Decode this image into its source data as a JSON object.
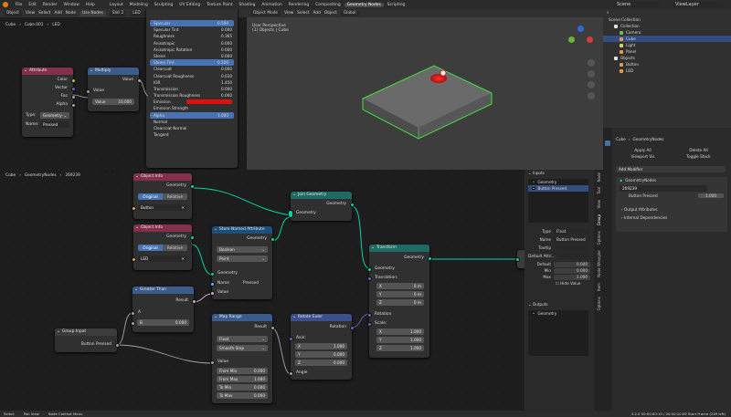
{
  "topbar": {
    "menus": [
      "File",
      "Edit",
      "Render",
      "Window",
      "Help"
    ],
    "workspaces": [
      "Layout",
      "Modeling",
      "Sculpting",
      "UV Editing",
      "Texture Paint",
      "Shading",
      "Animation",
      "Rendering",
      "Compositing",
      "Geometry Nodes",
      "Scripting"
    ],
    "active_workspace": "Geometry Nodes",
    "scene": "Scene",
    "view_layer": "ViewLayer"
  },
  "shader_editor": {
    "header": {
      "editor": "Object",
      "view": "View",
      "select": "Select",
      "add": "Add",
      "node": "Node",
      "use_nodes": "Use Nodes",
      "slot": "Slot 2",
      "material": "LED"
    },
    "breadcrumb": [
      "Cube",
      "Cube.001",
      "LED"
    ],
    "attribute_node": {
      "title": "Attribute",
      "outputs": [
        "Color",
        "Vector",
        "Fac",
        "Alpha"
      ],
      "type_label": "Type:",
      "type_value": "Geometry",
      "name_label": "Name:",
      "name_value": "Pressed"
    },
    "multiply_node": {
      "title": "Multiply",
      "value_out": "Value",
      "value_in": "Value",
      "value_field": "Value",
      "value_num": "10.000"
    },
    "bsdf_rows": [
      {
        "label": "Specular",
        "value": "0.500",
        "hl": true
      },
      {
        "label": "Specular Tint",
        "value": "0.000"
      },
      {
        "label": "Roughness",
        "value": "0.365"
      },
      {
        "label": "Anisotropic",
        "value": "0.000"
      },
      {
        "label": "Anisotropic Rotation",
        "value": "0.000"
      },
      {
        "label": "Sheen",
        "value": "0.000"
      },
      {
        "label": "Sheen Tint",
        "value": "0.500",
        "hl": true
      },
      {
        "label": "Clearcoat",
        "value": "0.000"
      },
      {
        "label": "Clearcoat Roughness",
        "value": "0.030"
      },
      {
        "label": "IOR",
        "value": "1.450"
      },
      {
        "label": "Transmission",
        "value": "0.000"
      },
      {
        "label": "Transmission Roughness",
        "value": "0.000"
      }
    ],
    "emission_label": "Emission",
    "emission_color": "#e01010",
    "emission_strength": "Emission Strength",
    "alpha_label": "Alpha",
    "alpha_value": "1.000",
    "normal": "Normal",
    "clearcoat_normal": "Clearcoat Normal",
    "tangent": "Tangent"
  },
  "viewport": {
    "header": {
      "mode": "Object Mode",
      "view": "View",
      "select": "Select",
      "add": "Add",
      "object": "Object",
      "orientation": "Global"
    },
    "overlay_title": "User Perspective",
    "overlay_subtitle": "(1) Objects | Cube"
  },
  "outliner": {
    "title": "Scene Collection",
    "items": [
      {
        "label": "Collection",
        "indent": 1,
        "icon": "collection-icon"
      },
      {
        "label": "Camera",
        "indent": 2,
        "icon": "camera-icon"
      },
      {
        "label": "Cube",
        "indent": 2,
        "icon": "mesh-icon",
        "selected": true
      },
      {
        "label": "Light",
        "indent": 2,
        "icon": "light-icon"
      },
      {
        "label": "Panel",
        "indent": 2,
        "icon": "mesh-icon"
      },
      {
        "label": "Objects",
        "indent": 1,
        "icon": "collection-icon"
      },
      {
        "label": "Button",
        "indent": 2,
        "icon": "mesh-icon"
      },
      {
        "label": "LED",
        "indent": 2,
        "icon": "mesh-icon"
      }
    ]
  },
  "properties": {
    "object": "Cube",
    "modifier_name": "GeometryNodes",
    "apply_all": "Apply All",
    "delete_all": "Delete All",
    "viewport_vis": "Viewport Vis",
    "toggle_stack": "Toggle Stack",
    "add_modifier": "Add Modifier",
    "mod_title": "GeometryNodes",
    "node_group": "269239",
    "button_pressed_label": "Button Pressed",
    "button_pressed_value": "1.000",
    "output_attributes": "Output Attributes",
    "internal_dependencies": "Internal Dependencies"
  },
  "geo_editor": {
    "breadcrumb": [
      "Cube",
      "GeometryNodes",
      "269239"
    ],
    "nodes": {
      "object_info_1": {
        "title": "Object Info",
        "geometry": "Geometry",
        "original": "Original",
        "relative": "Relative",
        "object": "Button"
      },
      "object_info_2": {
        "title": "Object Info",
        "geometry": "Geometry",
        "original": "Original",
        "relative": "Relative",
        "object": "LED"
      },
      "join": {
        "title": "Join Geometry",
        "out": "Geometry",
        "in": "Geometry"
      },
      "store": {
        "title": "Store Named Attribute",
        "out": "Geometry",
        "type": "Boolean",
        "domain": "Point",
        "geometry": "Geometry",
        "name_label": "Name",
        "name_value": "Pressed",
        "value": "Value"
      },
      "greater": {
        "title": "Greater Than",
        "result": "Result",
        "a": "A",
        "b": "B",
        "b_value": "0.000"
      },
      "group_input": {
        "title": "Group Input",
        "out": "Button Pressed"
      },
      "map_range": {
        "title": "Map Range",
        "result": "Result",
        "type": "Float",
        "interp": "Smooth Step",
        "value": "Value",
        "fields": [
          {
            "label": "From Min",
            "value": "0.000"
          },
          {
            "label": "From Max",
            "value": "1.000"
          },
          {
            "label": "To Min",
            "value": "0.000"
          },
          {
            "label": "To Max",
            "value": "0.060"
          }
        ]
      },
      "rotate": {
        "title": "Rotate Euler",
        "rotation": "Rotation",
        "axis": "Axis:",
        "fields": [
          {
            "label": "X",
            "value": "1.000"
          },
          {
            "label": "Y",
            "value": "0.000"
          },
          {
            "label": "Z",
            "value": "0.000"
          }
        ],
        "angle": "Angle"
      },
      "transform": {
        "title": "Transform",
        "geometry_out": "Geometry",
        "geometry_in": "Geometry",
        "translation": "Translation:",
        "translation_fields": [
          {
            "label": "X",
            "value": "0 m"
          },
          {
            "label": "Y",
            "value": "0 m"
          },
          {
            "label": "Z",
            "value": "0 m"
          }
        ],
        "rotation": "Rotation",
        "scale": "Scale:",
        "scale_fields": [
          {
            "label": "X",
            "value": "1.000"
          },
          {
            "label": "Y",
            "value": "1.000"
          },
          {
            "label": "Z",
            "value": "1.000"
          }
        ]
      }
    },
    "sidebar": {
      "inputs_title": "Inputs",
      "inputs": [
        "Geometry",
        "Button Pressed"
      ],
      "type_label": "Type",
      "type_value": "Float",
      "name_label": "Name",
      "name_value": "Button Pressed",
      "tooltip_label": "Tooltip",
      "default_attr_label": "Default Attri...",
      "default_label": "Default",
      "default_value": "0.000",
      "min_label": "Min",
      "min_value": "0.000",
      "max_label": "Max",
      "max_value": "1.000",
      "hide_value": "Hide Value",
      "outputs_title": "Outputs",
      "outputs": [
        "Geometry"
      ]
    },
    "vtabs": [
      "Node",
      "Tool",
      "View",
      "Group",
      "Options",
      "Node Wrangler",
      "Item",
      "Options"
    ]
  },
  "statusbar": {
    "select": "Select",
    "pan": "Pan View",
    "context": "Node Context Menu",
    "version": "3.2.0  00:00:00:10 / 00:00:10:09  Start Frame (249 left)"
  }
}
